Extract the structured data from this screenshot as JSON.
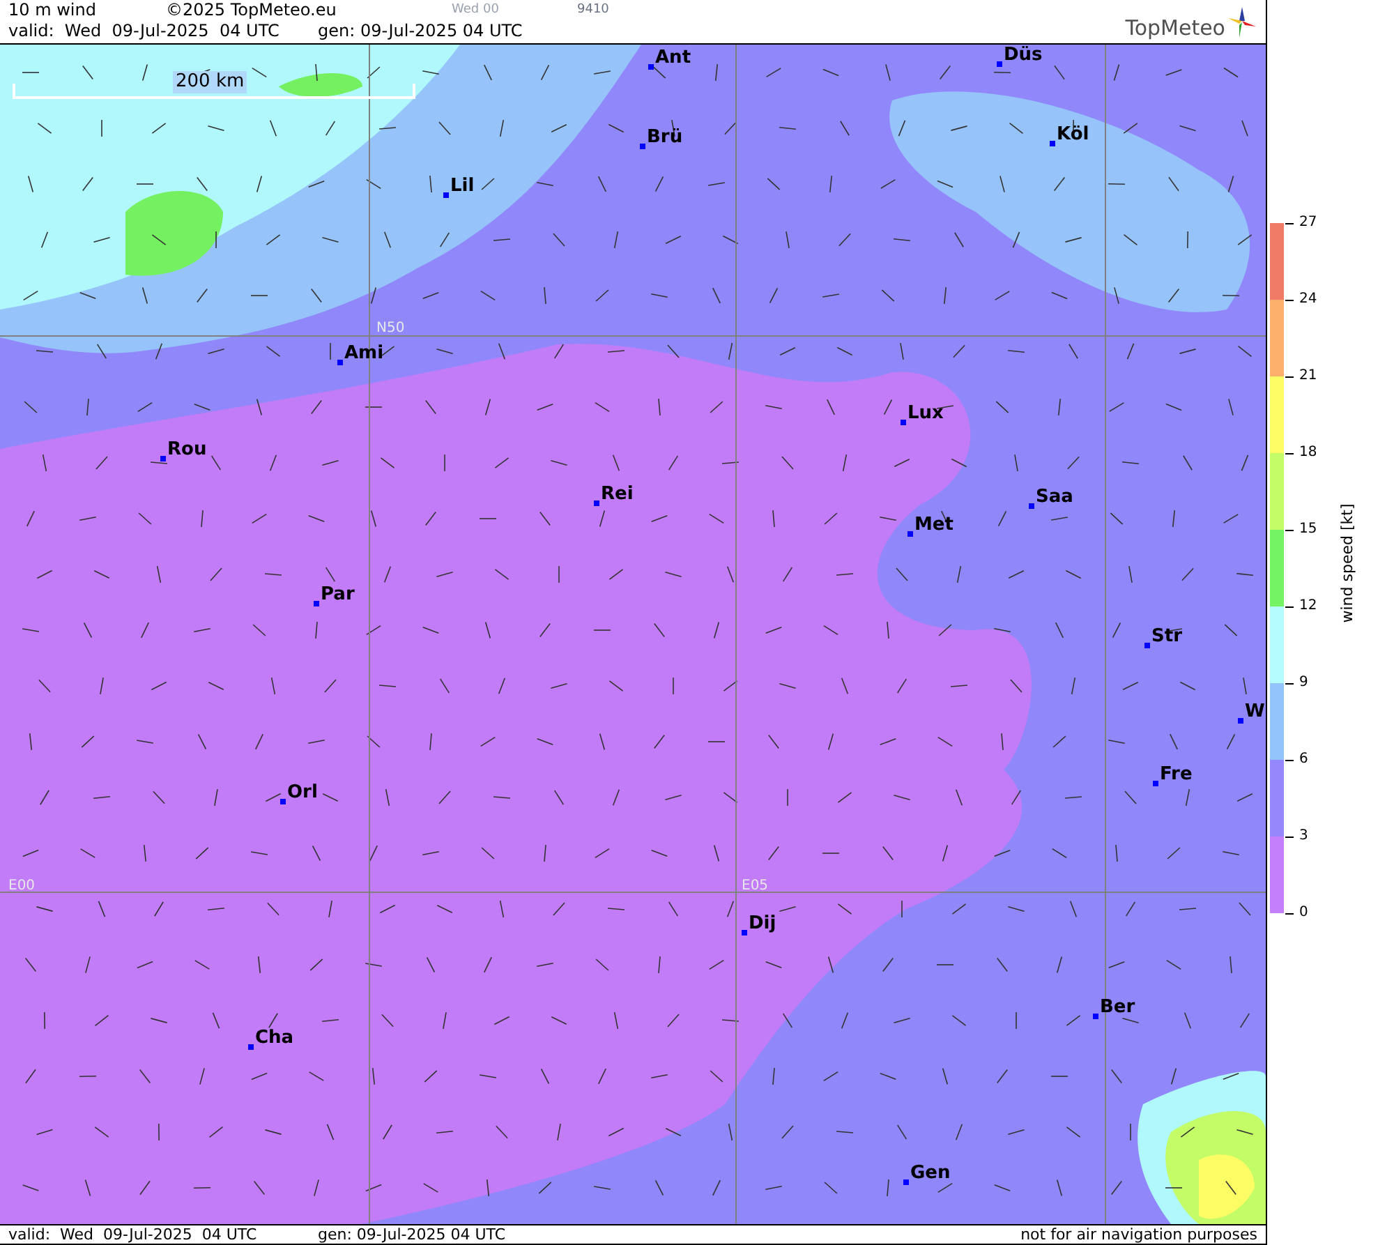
{
  "header": {
    "title": "10 m wind",
    "copyright": "©2025 TopMeteo.eu",
    "run": "Wed 00",
    "code": "9410",
    "valid": "valid:  Wed  09-Jul-2025  04 UTC",
    "generated": "gen: 09-Jul-2025 04 UTC",
    "logo": "TopMeteo"
  },
  "map": {
    "scale": "200 km",
    "grid_labels": [
      "N50",
      "E00",
      "E05"
    ],
    "cities": [
      "Ant",
      "Düs",
      "Brü",
      "Köl",
      "Lil",
      "Ami",
      "Rou",
      "Rei",
      "Lux",
      "Saa",
      "Met",
      "Par",
      "Str",
      "W",
      "Fre",
      "Orl",
      "Dij",
      "Ber",
      "Cha",
      "Gen"
    ]
  },
  "legend": {
    "title": "wind speed [kt]",
    "ticks": [
      "27",
      "24",
      "21",
      "18",
      "15",
      "12",
      "9",
      "6",
      "3",
      "0"
    ],
    "bands": [
      {
        "color": "#f07c68"
      },
      {
        "color": "#fcb06c"
      },
      {
        "color": "#fcfc64"
      },
      {
        "color": "#c4fc68"
      },
      {
        "color": "#74f464"
      },
      {
        "color": "#b4fcfc"
      },
      {
        "color": "#94c4fc"
      },
      {
        "color": "#9488fc"
      },
      {
        "color": "#c480fc"
      }
    ]
  },
  "footer": {
    "valid": "valid:  Wed  09-Jul-2025  04 UTC",
    "generated": "gen: 09-Jul-2025 04 UTC",
    "notice": "not for air navigation purposes"
  }
}
